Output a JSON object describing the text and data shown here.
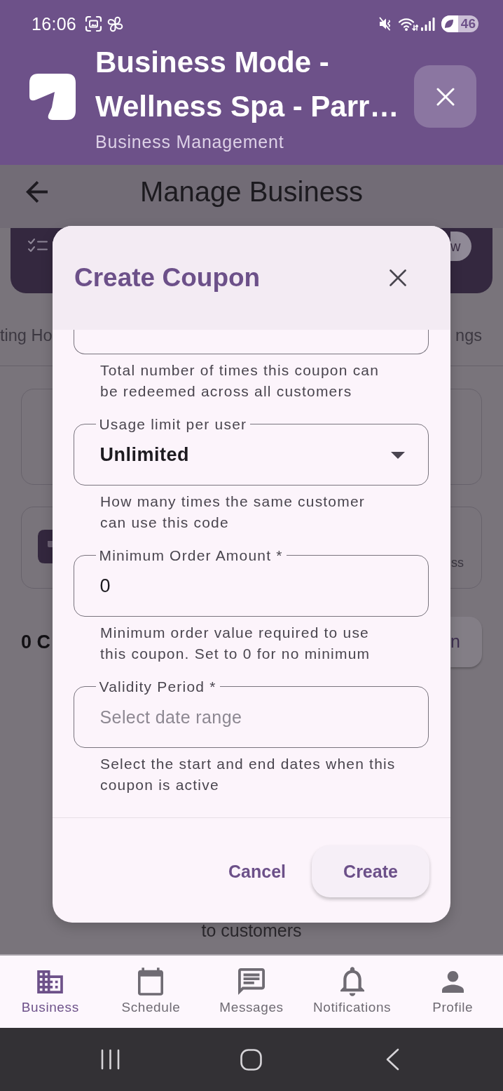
{
  "status_bar": {
    "time": "16:06",
    "battery": "46"
  },
  "header": {
    "title": "Business Mode - Wellness Spa - Parr…",
    "subtitle": "Business Management"
  },
  "page": {
    "title": "Manage Business",
    "banner_button": "w",
    "tabs": [
      {
        "label": "ting Ho"
      },
      {
        "label": "ngs"
      }
    ],
    "cards": [
      {
        "kind": "plain"
      },
      {
        "kind": "icon",
        "text": "ss"
      }
    ],
    "count": "0 C",
    "count_button": "n",
    "note": "to customers"
  },
  "dialog": {
    "title": "Create Coupon",
    "fields": [
      {
        "kind": "clipped",
        "helper": "Total number of times this coupon can be redeemed across all customers"
      },
      {
        "kind": "dropdown",
        "label": "Usage limit per user",
        "value": "Unlimited",
        "helper": "How many times the same customer can use this code"
      },
      {
        "kind": "text",
        "label": "Minimum Order Amount *",
        "value": "0",
        "helper": "Minimum order value required to use this coupon. Set to 0 for no minimum"
      },
      {
        "kind": "date",
        "label": "Validity Period *",
        "placeholder": "Select date range",
        "helper": "Select the start and end dates when this coupon is active"
      }
    ],
    "actions": [
      {
        "kind": "text",
        "label": "Cancel"
      },
      {
        "kind": "tonal",
        "label": "Create"
      }
    ]
  },
  "bottom_nav": [
    {
      "label": "Business",
      "selected": true
    },
    {
      "label": "Schedule",
      "selected": false
    },
    {
      "label": "Messages",
      "selected": false
    },
    {
      "label": "Notifications",
      "selected": false
    },
    {
      "label": "Profile",
      "selected": false
    }
  ]
}
